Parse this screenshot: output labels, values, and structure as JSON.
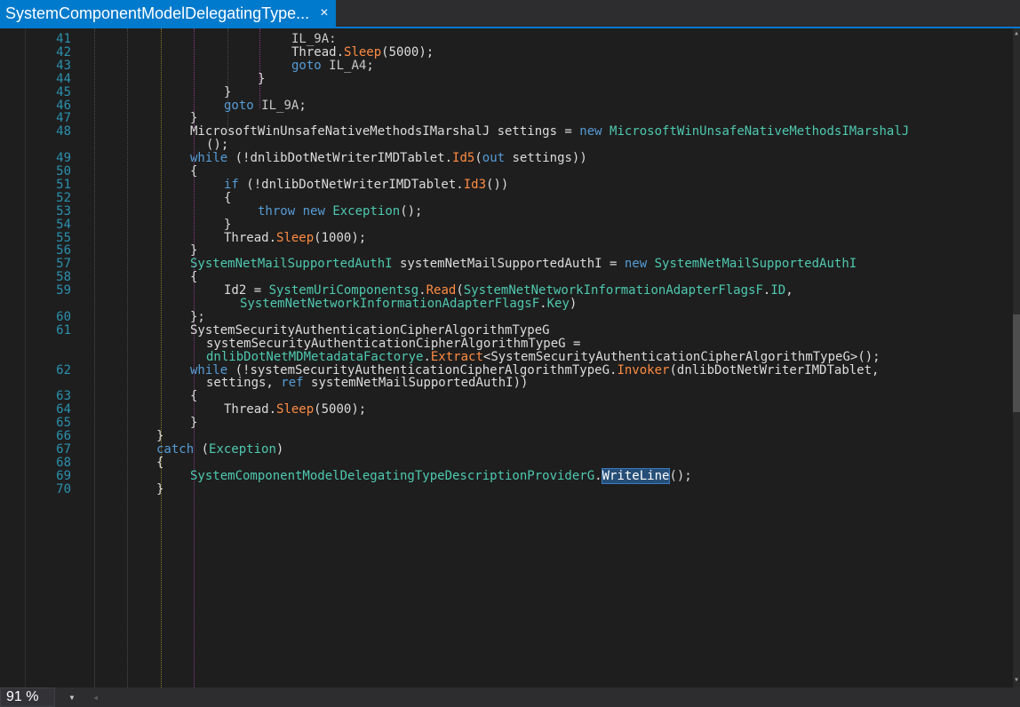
{
  "tab": {
    "title": "SystemComponentModelDelegatingType...",
    "close_glyph": "×"
  },
  "status": {
    "zoom": "91 %",
    "zoom_arrow": "▾",
    "scroll_left": "◂"
  },
  "scroll": {
    "up": "▴",
    "down": "▾"
  },
  "colors": {
    "keyword": "#569cd6",
    "type": "#4ec9b0",
    "method": "#ff8c42",
    "line_number": "#2b91af",
    "accent": "#007acc"
  },
  "lines": [
    {
      "n": "41",
      "indent": 4,
      "t": [
        [
          "lbl",
          "IL_9A:"
        ]
      ]
    },
    {
      "n": "42",
      "indent": 4,
      "t": [
        [
          "plain",
          "Thread."
        ],
        [
          "met",
          "Sleep"
        ],
        [
          "plain",
          "(5000);"
        ]
      ]
    },
    {
      "n": "43",
      "indent": 4,
      "t": [
        [
          "kw",
          "goto"
        ],
        [
          "plain",
          " "
        ],
        [
          "lbl",
          "IL_A4"
        ],
        [
          "plain",
          ";"
        ]
      ]
    },
    {
      "n": "44",
      "indent": 3,
      "t": [
        [
          "plain",
          "}"
        ]
      ]
    },
    {
      "n": "45",
      "indent": 2,
      "t": [
        [
          "plain",
          "}"
        ]
      ]
    },
    {
      "n": "46",
      "indent": 2,
      "t": [
        [
          "kw",
          "goto"
        ],
        [
          "plain",
          " "
        ],
        [
          "lbl",
          "IL_9A"
        ],
        [
          "plain",
          ";"
        ]
      ]
    },
    {
      "n": "47",
      "indent": 1,
      "t": [
        [
          "plain",
          "}"
        ]
      ]
    },
    {
      "n": "48",
      "indent": 1,
      "t": [
        [
          "plain",
          "MicrosoftWinUnsafeNativeMethodsIMarshalJ settings = "
        ],
        [
          "kw",
          "new"
        ],
        [
          "plain",
          " "
        ],
        [
          "type",
          "MicrosoftWinUnsafeNativeMethodsIMarshalJ"
        ]
      ]
    },
    {
      "n": "",
      "indent": 1,
      "cont": 1,
      "t": [
        [
          "plain",
          "();"
        ]
      ]
    },
    {
      "n": "49",
      "indent": 1,
      "t": [
        [
          "kw",
          "while"
        ],
        [
          "plain",
          " (!dnlibDotNetWriterIMDTablet."
        ],
        [
          "met",
          "Id5"
        ],
        [
          "plain",
          "("
        ],
        [
          "kw",
          "out"
        ],
        [
          "plain",
          " settings))"
        ]
      ]
    },
    {
      "n": "50",
      "indent": 1,
      "t": [
        [
          "plain",
          "{"
        ]
      ]
    },
    {
      "n": "51",
      "indent": 2,
      "t": [
        [
          "kw",
          "if"
        ],
        [
          "plain",
          " (!dnlibDotNetWriterIMDTablet."
        ],
        [
          "met",
          "Id3"
        ],
        [
          "plain",
          "())"
        ]
      ]
    },
    {
      "n": "52",
      "indent": 2,
      "t": [
        [
          "plain",
          "{"
        ]
      ]
    },
    {
      "n": "53",
      "indent": 3,
      "t": [
        [
          "kw",
          "throw"
        ],
        [
          "plain",
          " "
        ],
        [
          "kw",
          "new"
        ],
        [
          "plain",
          " "
        ],
        [
          "type",
          "Exception"
        ],
        [
          "plain",
          "();"
        ]
      ]
    },
    {
      "n": "54",
      "indent": 2,
      "t": [
        [
          "plain",
          "}"
        ]
      ]
    },
    {
      "n": "55",
      "indent": 2,
      "t": [
        [
          "plain",
          "Thread."
        ],
        [
          "met",
          "Sleep"
        ],
        [
          "plain",
          "(1000);"
        ]
      ]
    },
    {
      "n": "56",
      "indent": 1,
      "t": [
        [
          "plain",
          "}"
        ]
      ]
    },
    {
      "n": "57",
      "indent": 1,
      "t": [
        [
          "type",
          "SystemNetMailSupportedAuthI"
        ],
        [
          "plain",
          " systemNetMailSupportedAuthI = "
        ],
        [
          "kw",
          "new"
        ],
        [
          "plain",
          " "
        ],
        [
          "type",
          "SystemNetMailSupportedAuthI"
        ]
      ]
    },
    {
      "n": "58",
      "indent": 1,
      "t": [
        [
          "plain",
          "{"
        ]
      ]
    },
    {
      "n": "59",
      "indent": 2,
      "t": [
        [
          "plain",
          "Id2 = "
        ],
        [
          "type",
          "SystemUriComponentsg"
        ],
        [
          "plain",
          "."
        ],
        [
          "met",
          "Read"
        ],
        [
          "plain",
          "("
        ],
        [
          "type",
          "SystemNetNetworkInformationAdapterFlagsF"
        ],
        [
          "plain",
          "."
        ],
        [
          "type",
          "ID"
        ],
        [
          "plain",
          ","
        ]
      ]
    },
    {
      "n": "",
      "indent": 2,
      "cont": 1,
      "t": [
        [
          "type",
          "SystemNetNetworkInformationAdapterFlagsF"
        ],
        [
          "plain",
          "."
        ],
        [
          "type",
          "Key"
        ],
        [
          "plain",
          ")"
        ]
      ]
    },
    {
      "n": "60",
      "indent": 1,
      "t": [
        [
          "plain",
          "};"
        ]
      ]
    },
    {
      "n": "61",
      "indent": 1,
      "t": [
        [
          "plain",
          "SystemSecurityAuthenticationCipherAlgorithmTypeG"
        ]
      ]
    },
    {
      "n": "",
      "indent": 1,
      "cont": 1,
      "t": [
        [
          "plain",
          "systemSecurityAuthenticationCipherAlgorithmTypeG ="
        ]
      ]
    },
    {
      "n": "",
      "indent": 1,
      "cont": 1,
      "t": [
        [
          "type",
          "dnlibDotNetMDMetadataFactorye"
        ],
        [
          "plain",
          "."
        ],
        [
          "met",
          "Extract"
        ],
        [
          "plain",
          "<SystemSecurityAuthenticationCipherAlgorithmTypeG>();"
        ]
      ]
    },
    {
      "n": "62",
      "indent": 1,
      "t": [
        [
          "kw",
          "while"
        ],
        [
          "plain",
          " (!systemSecurityAuthenticationCipherAlgorithmTypeG."
        ],
        [
          "met",
          "Invoker"
        ],
        [
          "plain",
          "(dnlibDotNetWriterIMDTablet,"
        ]
      ]
    },
    {
      "n": "",
      "indent": 1,
      "cont": 1,
      "t": [
        [
          "plain",
          "settings, "
        ],
        [
          "kw",
          "ref"
        ],
        [
          "plain",
          " systemNetMailSupportedAuthI))"
        ]
      ]
    },
    {
      "n": "63",
      "indent": 1,
      "t": [
        [
          "plain",
          "{"
        ]
      ]
    },
    {
      "n": "64",
      "indent": 2,
      "t": [
        [
          "plain",
          "Thread."
        ],
        [
          "met",
          "Sleep"
        ],
        [
          "plain",
          "(5000);"
        ]
      ]
    },
    {
      "n": "65",
      "indent": 1,
      "t": [
        [
          "plain",
          "}"
        ]
      ]
    },
    {
      "n": "66",
      "indent": 0,
      "t": [
        [
          "plain",
          "}"
        ]
      ]
    },
    {
      "n": "67",
      "indent": 0,
      "t": [
        [
          "kw",
          "catch"
        ],
        [
          "plain",
          " ("
        ],
        [
          "type",
          "Exception"
        ],
        [
          "plain",
          ")"
        ]
      ]
    },
    {
      "n": "68",
      "indent": 0,
      "t": [
        [
          "plain",
          "{"
        ]
      ]
    },
    {
      "n": "69",
      "indent": 1,
      "t": [
        [
          "type",
          "SystemComponentModelDelegatingTypeDescriptionProviderG"
        ],
        [
          "plain",
          "."
        ],
        [
          "hl",
          "WriteLine"
        ],
        [
          "plain",
          "();"
        ]
      ]
    },
    {
      "n": "70",
      "indent": 0,
      "t": [
        [
          "plain",
          "}"
        ]
      ]
    }
  ]
}
